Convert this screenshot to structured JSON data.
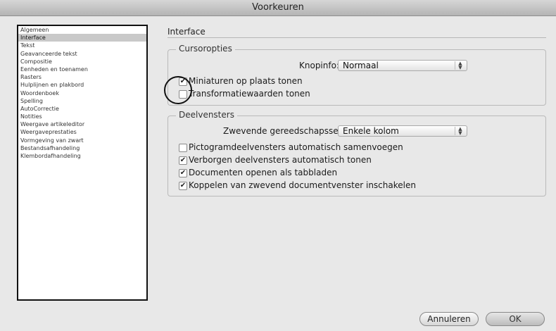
{
  "window": {
    "title": "Voorkeuren"
  },
  "sidebar": {
    "items": [
      {
        "label": "Algemeen",
        "selected": false
      },
      {
        "label": "Interface",
        "selected": true
      },
      {
        "label": "Tekst",
        "selected": false
      },
      {
        "label": "Geavanceerde tekst",
        "selected": false
      },
      {
        "label": "Compositie",
        "selected": false
      },
      {
        "label": "Eenheden en toenamen",
        "selected": false
      },
      {
        "label": "Rasters",
        "selected": false
      },
      {
        "label": "Hulplijnen en plakbord",
        "selected": false
      },
      {
        "label": "Woordenboek",
        "selected": false
      },
      {
        "label": "Spelling",
        "selected": false
      },
      {
        "label": "AutoCorrectie",
        "selected": false
      },
      {
        "label": "Notities",
        "selected": false
      },
      {
        "label": "Weergave artikeleditor",
        "selected": false
      },
      {
        "label": "Weergaveprestaties",
        "selected": false
      },
      {
        "label": "Vormgeving van zwart",
        "selected": false
      },
      {
        "label": "Bestandsafhandeling",
        "selected": false
      },
      {
        "label": "Klembordafhandeling",
        "selected": false
      }
    ]
  },
  "panel": {
    "title": "Interface",
    "cursor_group": {
      "title": "Cursoropties",
      "knopinfo_label": "Knopinfo:",
      "knopinfo_value": "Normaal",
      "checks": [
        {
          "label": "Miniaturen op plaats tonen",
          "checked": true
        },
        {
          "label": "Transformatiewaarden tonen",
          "checked": false
        }
      ]
    },
    "panels_group": {
      "title": "Deelvensters",
      "toolset_label": "Zwevende gereedschapsset:",
      "toolset_value": "Enkele kolom",
      "checks": [
        {
          "label": "Pictogramdeelvensters automatisch samenvoegen",
          "checked": false
        },
        {
          "label": "Verborgen deelvensters automatisch tonen",
          "checked": true
        },
        {
          "label": "Documenten openen als tabbladen",
          "checked": true
        },
        {
          "label": "Koppelen van zwevend documentvenster inschakelen",
          "checked": true
        }
      ]
    }
  },
  "buttons": {
    "cancel": "Annuleren",
    "ok": "OK"
  },
  "glyphs": {
    "check": "✔",
    "select_arrows": "▲▼"
  }
}
